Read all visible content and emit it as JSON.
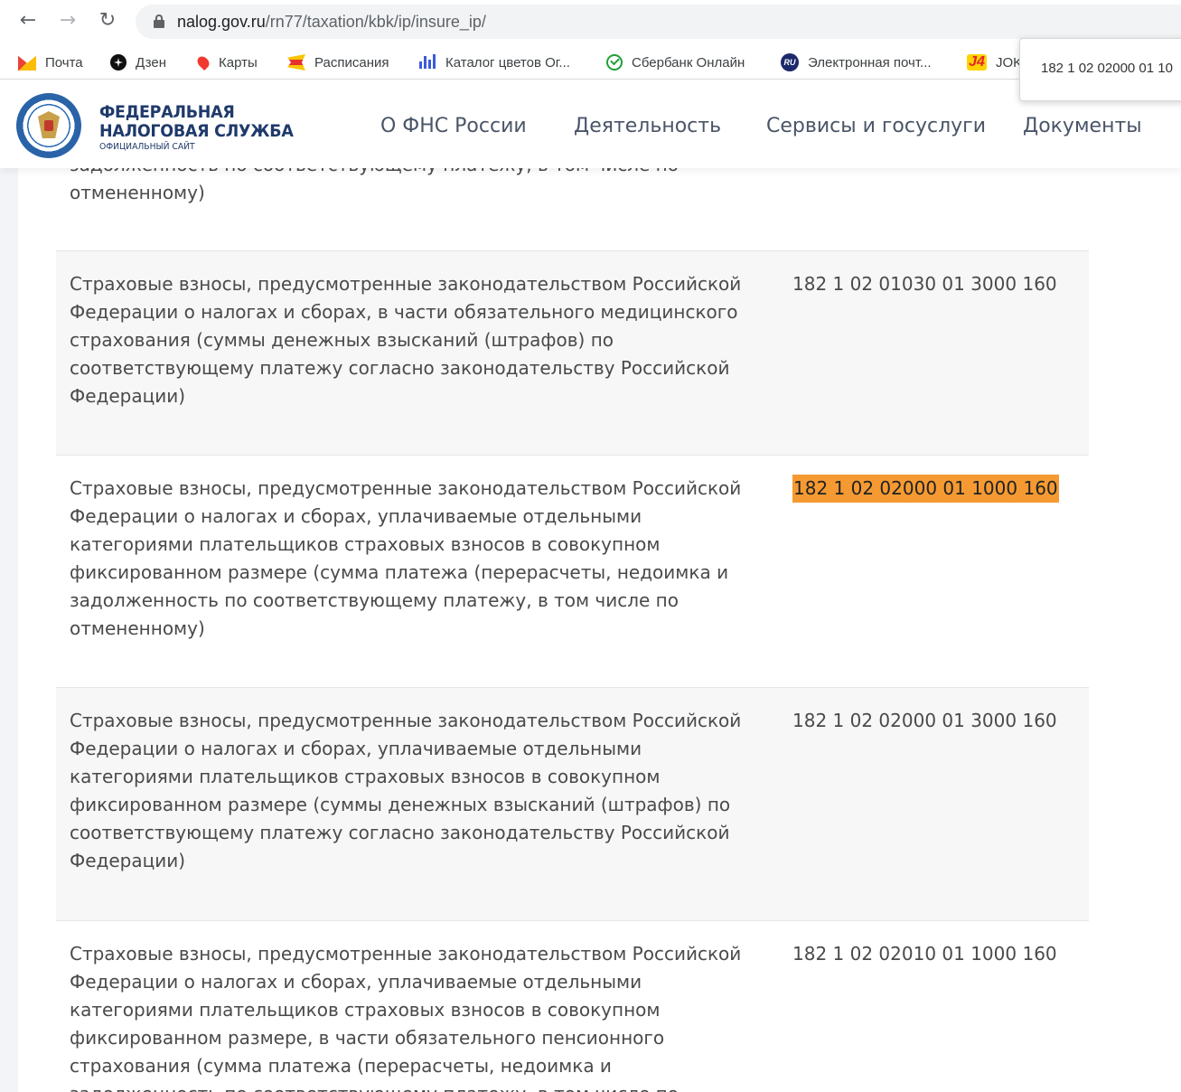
{
  "browser": {
    "url_host": "nalog.gov.ru",
    "url_path": "/rn77/taxation/kbk/ip/insure_ip/"
  },
  "bookmarks": [
    {
      "label": "Почта",
      "icon": "mail-icon"
    },
    {
      "label": "Дзен",
      "icon": "dzen-icon"
    },
    {
      "label": "Карты",
      "icon": "map-pin-icon"
    },
    {
      "label": "Расписания",
      "icon": "schedule-icon"
    },
    {
      "label": "Каталог цветов Ог...",
      "icon": "bars-icon"
    },
    {
      "label": "Сбербанк Онлайн",
      "icon": "sberbank-icon"
    },
    {
      "label": "Электронная почт...",
      "icon": "ru-mail-icon"
    },
    {
      "label": "JOK",
      "icon": "j4-icon"
    }
  ],
  "tooltip": {
    "text": "182 1 02 02000 01 10"
  },
  "site": {
    "brand_line1": "ФЕДЕРАЛЬНАЯ",
    "brand_line2": "НАЛОГОВАЯ СЛУЖБА",
    "brand_sub": "ОФИЦИАЛЬНЫЙ САЙТ",
    "menu": [
      "О ФНС России",
      "Деятельность",
      "Сервисы и госуслуги",
      "Документы"
    ]
  },
  "table": {
    "partial_top": {
      "desc_hidden": "задолженность по соответствующему платежу, в том числе по",
      "desc_visible": "отмененному)"
    },
    "rows": [
      {
        "desc": "Страховые взносы, предусмотренные законодательством Российской Федерации о налогах и сборах, в части обязательного медицинского страхования (суммы денежных взысканий (штрафов) по соответствующему платежу согласно законодательству Российской Федерации)",
        "code": "182 1 02 01030 01 3000 160"
      },
      {
        "desc": "Страховые взносы, предусмотренные законодательством Российской Федерации о налогах и сборах, уплачиваемые отдельными категориями плательщиков страховых взносов в совокупном фиксированном размере (сумма платежа (перерасчеты, недоимка и задолженность по соответствующему платежу, в том числе по отмененному)",
        "code": "182 1 02 02000 01 1000 160",
        "highlight_color": "#f59a32"
      },
      {
        "desc": "Страховые взносы, предусмотренные законодательством Российской Федерации о налогах и сборах, уплачиваемые отдельными категориями плательщиков страховых взносов в совокупном фиксированном размере (суммы денежных взысканий (штрафов) по соответствующему платежу согласно законодательству Российской Федерации)",
        "code": "182 1 02 02000 01 3000 160"
      },
      {
        "desc": "Страховые взносы, предусмотренные законодательством Российской Федерации о налогах и сборах, уплачиваемые отдельными категориями плательщиков страховых взносов в совокупном фиксированном размере, в части обязательного пенсионного страхования (сумма платежа (перерасчеты, недоимка и задолженность по соответствующему платежу, в том числе по",
        "code": "182 1 02 02010 01 1000 160"
      }
    ]
  }
}
